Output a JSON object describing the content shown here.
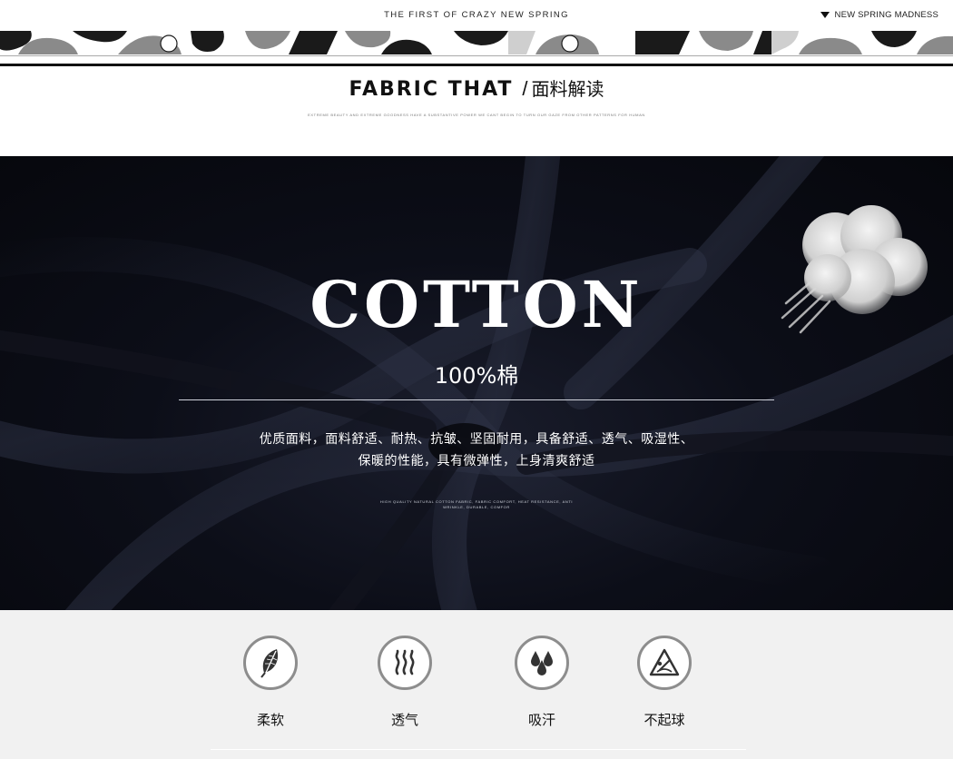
{
  "header": {
    "tagline": "THE FIRST OF CRAZY NEW SPRING",
    "right_label": "NEW SPRING MADNESS",
    "right_icon": "triangle-down-icon"
  },
  "section": {
    "title_en": "FABRIC THAT",
    "separator": "/",
    "title_cn": "面料解读",
    "fine_print": "EXTREME BEAUTY AND EXTREME GOODNESS HAVE A SUBSTANTIVE POWER WE CANT BEGIN TO TURN OUR GAZE FROM OTHER PATTERNS FOR HUMAN"
  },
  "hero": {
    "title": "COTTON",
    "percent": "100%棉",
    "description_line1": "优质面料，面料舒适、耐热、抗皱、坚固耐用，具备舒适、透气、吸湿性、",
    "description_line2": "保暖的性能，具有微弹性，上身清爽舒适",
    "fine_print": "HIGH QUALITY NATURAL COTTON FABRIC, FABRIC COMFORT, HEAT RESISTANCE, ANTI WRINKLE, DURABLE, COMFOR",
    "background_color": "#0a0c14"
  },
  "features": [
    {
      "label": "柔软",
      "icon": "feather-icon"
    },
    {
      "label": "透气",
      "icon": "heat-waves-icon"
    },
    {
      "label": "吸汗",
      "icon": "water-drops-icon"
    },
    {
      "label": "不起球",
      "icon": "anti-pilling-icon"
    }
  ]
}
